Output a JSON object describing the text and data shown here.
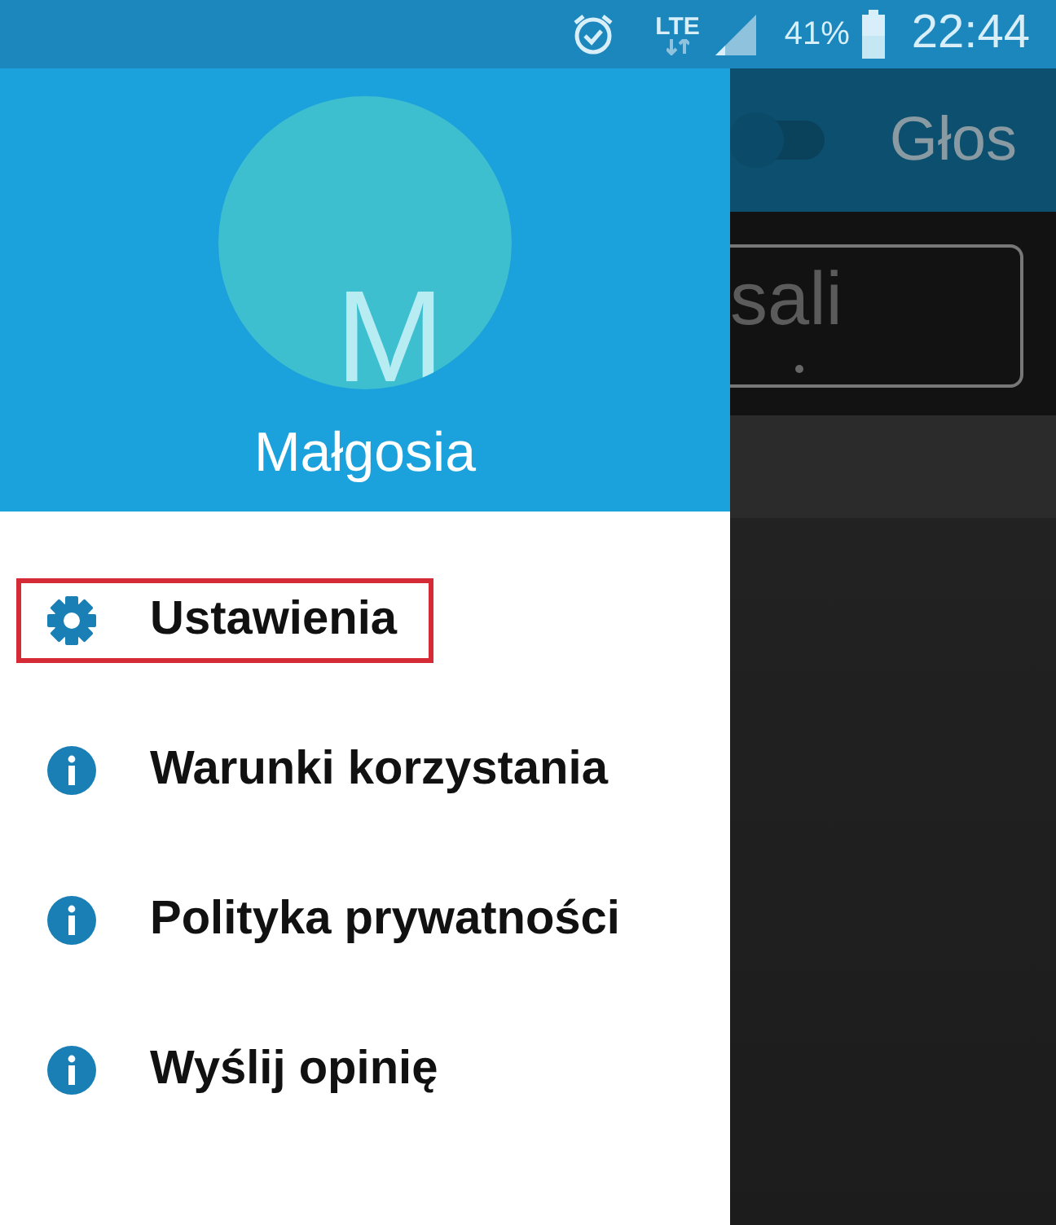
{
  "status_bar": {
    "network": "LTE",
    "battery": "41%",
    "time": "22:44"
  },
  "drawer": {
    "header": {
      "avatar_letter": "M",
      "user_name": "Małgosia"
    },
    "items": [
      {
        "kind": "settings",
        "label": "Ustawienia",
        "highlighted": true
      },
      {
        "kind": "info",
        "label": "Warunki korzystania",
        "highlighted": false
      },
      {
        "kind": "info",
        "label": "Polityka prywatności",
        "highlighted": false
      },
      {
        "kind": "info",
        "label": "Wyślij opinię",
        "highlighted": false
      }
    ]
  },
  "background_app": {
    "title": "Głos",
    "toggle": {
      "on": false
    },
    "field_text": "sali"
  }
}
